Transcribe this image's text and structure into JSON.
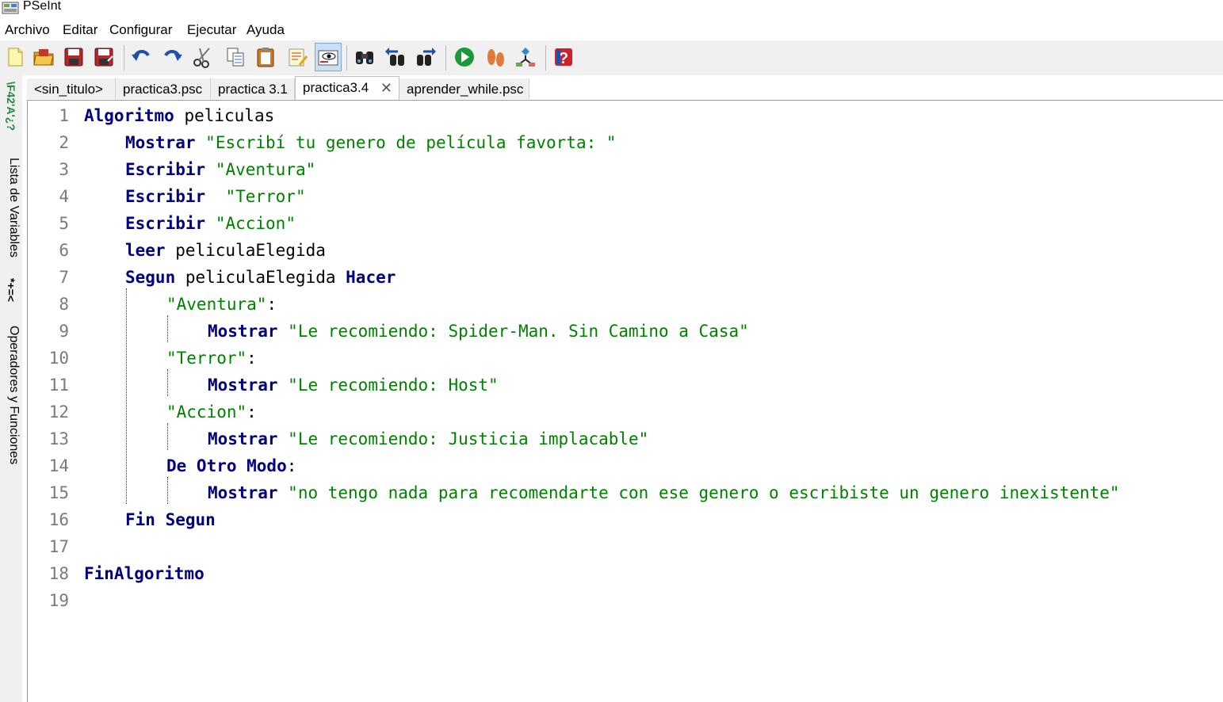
{
  "window": {
    "title": "PSeInt"
  },
  "menu": [
    "Archivo",
    "Editar",
    "Configurar",
    "Ejecutar",
    "Ayuda"
  ],
  "toolbar": [
    {
      "name": "new-file-icon",
      "tooltip": ""
    },
    {
      "name": "open-file-icon"
    },
    {
      "name": "save-icon"
    },
    {
      "name": "save-as-icon"
    },
    {
      "name": "undo-icon"
    },
    {
      "name": "redo-icon"
    },
    {
      "name": "cut-icon"
    },
    {
      "name": "copy-icon"
    },
    {
      "name": "paste-icon"
    },
    {
      "name": "edit-icon"
    },
    {
      "name": "view-icon"
    },
    {
      "name": "find-icon"
    },
    {
      "name": "find-prev-icon"
    },
    {
      "name": "find-next-icon"
    },
    {
      "name": "run-icon"
    },
    {
      "name": "step-icon"
    },
    {
      "name": "flowchart-icon"
    },
    {
      "name": "help-icon"
    }
  ],
  "side": {
    "variables_label": "Lista de Variables",
    "operators_label": "Operadores y Funciones",
    "icons_top": "\\F42'A'¿?",
    "icons_mid": "*+=<"
  },
  "tabs": [
    {
      "label": "<sin_titulo>",
      "active": false
    },
    {
      "label": "practica3.psc",
      "active": false
    },
    {
      "label": "practica 3.1",
      "active": false
    },
    {
      "label": "practica3.4",
      "active": true
    },
    {
      "label": "aprender_while.psc",
      "active": false
    }
  ],
  "tab_close": "✕",
  "code": [
    {
      "n": "1",
      "tokens": [
        [
          "kw",
          "Algoritmo"
        ],
        [
          "id",
          " peliculas"
        ]
      ]
    },
    {
      "n": "2",
      "tokens": [
        [
          "kw",
          "Mostrar"
        ],
        [
          "id",
          " "
        ],
        [
          "str",
          "\"Escribí tu genero de película favorta: \""
        ]
      ]
    },
    {
      "n": "3",
      "tokens": [
        [
          "kw",
          "Escribir"
        ],
        [
          "id",
          " "
        ],
        [
          "str",
          "\"Aventura\""
        ]
      ]
    },
    {
      "n": "4",
      "tokens": [
        [
          "kw",
          "Escribir"
        ],
        [
          "id",
          "  "
        ],
        [
          "str",
          "\"Terror\""
        ]
      ]
    },
    {
      "n": "5",
      "tokens": [
        [
          "kw",
          "Escribir"
        ],
        [
          "id",
          " "
        ],
        [
          "str",
          "\"Accion\""
        ]
      ]
    },
    {
      "n": "6",
      "tokens": [
        [
          "kw",
          "leer"
        ],
        [
          "id",
          " peliculaElegida"
        ]
      ]
    },
    {
      "n": "7",
      "tokens": [
        [
          "kw",
          "Segun"
        ],
        [
          "id",
          " peliculaElegida "
        ],
        [
          "kw",
          "Hacer"
        ]
      ]
    },
    {
      "n": "8",
      "tokens": [
        [
          "str",
          "\"Aventura\""
        ],
        [
          "id",
          ":"
        ]
      ]
    },
    {
      "n": "9",
      "tokens": [
        [
          "kw",
          "Mostrar"
        ],
        [
          "id",
          " "
        ],
        [
          "str",
          "\"Le recomiendo: Spider-Man. Sin Camino a Casa\""
        ]
      ]
    },
    {
      "n": "10",
      "tokens": [
        [
          "str",
          "\"Terror\""
        ],
        [
          "id",
          ":"
        ]
      ]
    },
    {
      "n": "11",
      "tokens": [
        [
          "kw",
          "Mostrar"
        ],
        [
          "id",
          " "
        ],
        [
          "str",
          "\"Le recomiendo: Host\""
        ]
      ]
    },
    {
      "n": "12",
      "tokens": [
        [
          "str",
          "\"Accion\""
        ],
        [
          "id",
          ":"
        ]
      ]
    },
    {
      "n": "13",
      "tokens": [
        [
          "kw",
          "Mostrar"
        ],
        [
          "id",
          " "
        ],
        [
          "str",
          "\"Le recomiendo: Justicia implacable\""
        ]
      ]
    },
    {
      "n": "14",
      "tokens": [
        [
          "kw",
          "De Otro Modo"
        ],
        [
          "id",
          ":"
        ]
      ]
    },
    {
      "n": "15",
      "tokens": [
        [
          "kw",
          "Mostrar"
        ],
        [
          "id",
          " "
        ],
        [
          "str",
          "\"no tengo nada para recomendarte con ese genero o escribiste un genero inexistente\""
        ]
      ]
    },
    {
      "n": "16",
      "tokens": [
        [
          "kw",
          "Fin Segun"
        ]
      ]
    },
    {
      "n": "17",
      "tokens": []
    },
    {
      "n": "18",
      "tokens": [
        [
          "kw",
          "FinAlgoritmo"
        ]
      ]
    },
    {
      "n": "19",
      "tokens": []
    }
  ],
  "colors": {
    "keyword": "#00007f",
    "string": "#007f00",
    "line_number": "#7a7a7a"
  }
}
